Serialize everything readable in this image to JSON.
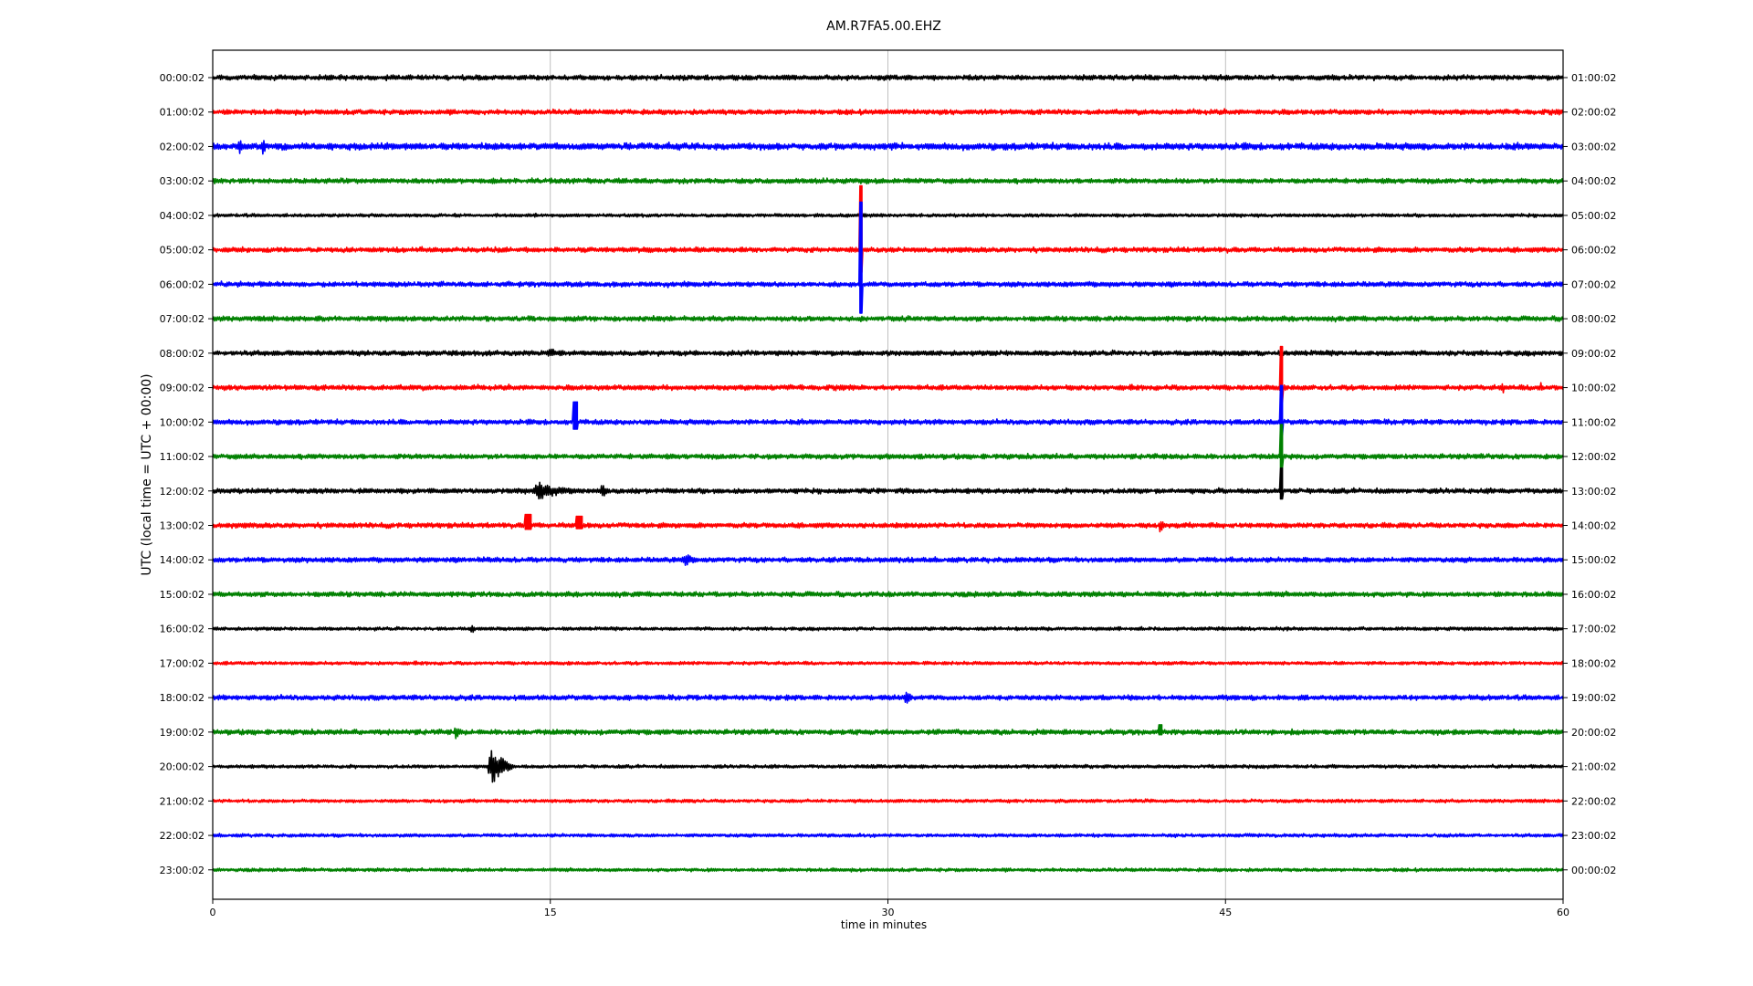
{
  "chart_data": {
    "type": "line",
    "title": "AM.R7FA5.00.EHZ",
    "xlabel": "time in minutes",
    "ylabel": "UTC (local time = UTC + 00:00)",
    "xlim": [
      0,
      60
    ],
    "x_ticks": [
      0,
      15,
      30,
      45,
      60
    ],
    "x_tick_labels": [
      "0",
      "15",
      "30",
      "45",
      "60"
    ],
    "grid": "vertical lines at 15, 30, 45",
    "colors": [
      "#000000",
      "#ff0000",
      "#0000ff",
      "#008000"
    ],
    "left_labels": [
      "00:00:02",
      "01:00:02",
      "02:00:02",
      "03:00:02",
      "04:00:02",
      "05:00:02",
      "06:00:02",
      "07:00:02",
      "08:00:02",
      "09:00:02",
      "10:00:02",
      "11:00:02",
      "12:00:02",
      "13:00:02",
      "14:00:02",
      "15:00:02",
      "16:00:02",
      "17:00:02",
      "18:00:02",
      "19:00:02",
      "20:00:02",
      "21:00:02",
      "22:00:02",
      "23:00:02"
    ],
    "right_labels": [
      "01:00:02",
      "02:00:02",
      "03:00:02",
      "04:00:02",
      "05:00:02",
      "06:00:02",
      "07:00:02",
      "08:00:02",
      "09:00:02",
      "10:00:02",
      "11:00:02",
      "12:00:02",
      "13:00:02",
      "14:00:02",
      "15:00:02",
      "16:00:02",
      "17:00:02",
      "18:00:02",
      "19:00:02",
      "20:00:02",
      "21:00:02",
      "22:00:02",
      "23:00:02",
      "00:00:02"
    ],
    "noise": [
      3,
      3,
      4,
      3,
      2,
      3,
      3,
      3,
      3,
      3,
      3,
      3,
      3,
      3,
      3,
      3,
      2,
      2,
      3,
      3,
      2,
      2,
      2,
      2
    ],
    "events": [
      {
        "trace": 2,
        "minute": 1.2,
        "amp": 8,
        "dur": 0.6
      },
      {
        "trace": 2,
        "minute": 2.2,
        "amp": 9,
        "dur": 0.5
      },
      {
        "trace": 5,
        "minute": 28.8,
        "amp": 70,
        "dur": 0.08,
        "spike": true
      },
      {
        "trace": 6,
        "minute": 28.8,
        "amp": 90,
        "dur": 0.08,
        "spike": true
      },
      {
        "trace": 8,
        "minute": 15.0,
        "amp": 6,
        "dur": 1.0
      },
      {
        "trace": 9,
        "minute": 47.5,
        "amp": 45,
        "dur": 0.06,
        "spike": true
      },
      {
        "trace": 9,
        "minute": 57.3,
        "amp": 10,
        "dur": 0.2
      },
      {
        "trace": 9,
        "minute": 59.0,
        "amp": 12,
        "dur": 0.2
      },
      {
        "trace": 10,
        "minute": 16.1,
        "amp": 22,
        "dur": 0.1,
        "spike": true
      },
      {
        "trace": 10,
        "minute": 47.5,
        "amp": 40,
        "dur": 0.06,
        "spike": true
      },
      {
        "trace": 11,
        "minute": 47.5,
        "amp": 35,
        "dur": 0.06,
        "spike": true
      },
      {
        "trace": 12,
        "minute": 14.5,
        "amp": 10,
        "dur": 2.5
      },
      {
        "trace": 12,
        "minute": 17.3,
        "amp": 9,
        "dur": 0.5
      },
      {
        "trace": 12,
        "minute": 47.5,
        "amp": 25,
        "dur": 0.06,
        "spike": true
      },
      {
        "trace": 13,
        "minute": 14.0,
        "amp": 12,
        "dur": 0.15,
        "spike": true
      },
      {
        "trace": 13,
        "minute": 16.3,
        "amp": 10,
        "dur": 0.15,
        "spike": true
      },
      {
        "trace": 13,
        "minute": 42.1,
        "amp": 8,
        "dur": 0.5
      },
      {
        "trace": 14,
        "minute": 21.0,
        "amp": 7,
        "dur": 1.0
      },
      {
        "trace": 16,
        "minute": 11.5,
        "amp": 6,
        "dur": 0.4
      },
      {
        "trace": 18,
        "minute": 30.8,
        "amp": 9,
        "dur": 0.5
      },
      {
        "trace": 19,
        "minute": 10.8,
        "amp": 8,
        "dur": 0.5
      },
      {
        "trace": 19,
        "minute": 42.1,
        "amp": 8,
        "dur": 0.1,
        "spike": true
      },
      {
        "trace": 20,
        "minute": 12.4,
        "amp": 25,
        "dur": 1.0
      }
    ]
  }
}
